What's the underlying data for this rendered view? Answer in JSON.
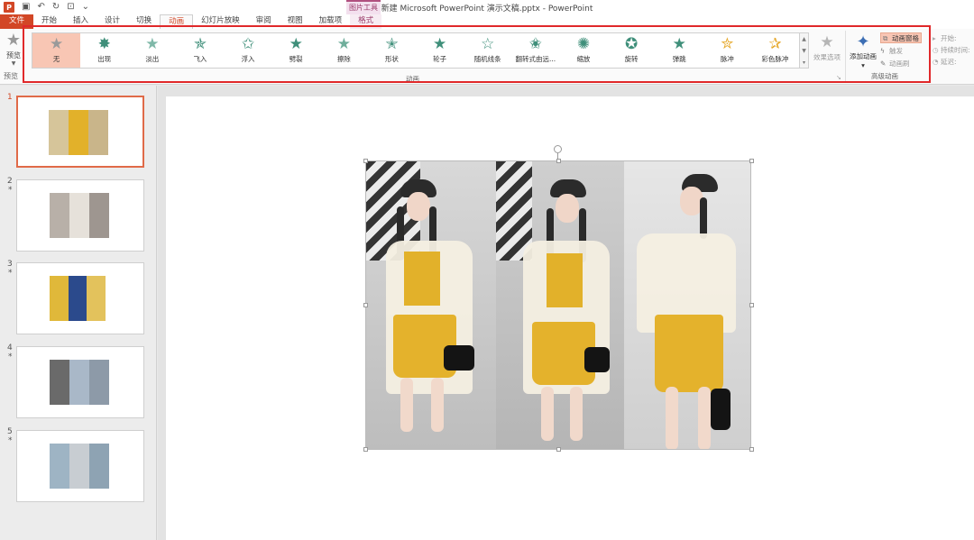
{
  "window": {
    "title": "新建 Microsoft PowerPoint 演示文稿.pptx - PowerPoint",
    "context_tool": "图片工具"
  },
  "tabs": [
    "文件",
    "开始",
    "插入",
    "设计",
    "切换",
    "动画",
    "幻灯片放映",
    "审阅",
    "视图",
    "加载项",
    "格式"
  ],
  "active_tab": "动画",
  "ribbon": {
    "preview": {
      "label": "预览",
      "group": "预览"
    },
    "animations": [
      {
        "label": "无",
        "icon": "star-gray-icon"
      },
      {
        "label": "出现",
        "icon": "star-burst-icon"
      },
      {
        "label": "淡出",
        "icon": "star-fade-icon"
      },
      {
        "label": "飞入",
        "icon": "star-fly-icon"
      },
      {
        "label": "浮入",
        "icon": "star-float-icon"
      },
      {
        "label": "劈裂",
        "icon": "star-split-icon"
      },
      {
        "label": "擦除",
        "icon": "star-wipe-icon"
      },
      {
        "label": "形状",
        "icon": "star-shape-icon"
      },
      {
        "label": "轮子",
        "icon": "star-wheel-icon"
      },
      {
        "label": "随机线条",
        "icon": "star-lines-icon"
      },
      {
        "label": "翻转式由远...",
        "icon": "star-flip-icon"
      },
      {
        "label": "缩放",
        "icon": "star-zoom-icon"
      },
      {
        "label": "旋转",
        "icon": "star-spin-icon"
      },
      {
        "label": "弹跳",
        "icon": "star-bounce-icon"
      },
      {
        "label": "脉冲",
        "icon": "star-pulse-icon"
      },
      {
        "label": "彩色脉冲",
        "icon": "star-color-pulse-icon"
      }
    ],
    "selected_animation": "无",
    "effect_options": "效果选项",
    "group_animation": "动画",
    "advanced": {
      "add_animation": "添加动画",
      "animation_pane": "动画窗格",
      "trigger": "触发",
      "painter": "动画刷",
      "group": "高级动画"
    },
    "timing": {
      "start": "开始:",
      "duration": "持续时间:",
      "delay": "延迟:"
    }
  },
  "slides": [
    {
      "number": "1",
      "has_star": false,
      "active": true
    },
    {
      "number": "2",
      "has_star": true,
      "active": false
    },
    {
      "number": "3",
      "has_star": true,
      "active": false
    },
    {
      "number": "4",
      "has_star": true,
      "active": false
    },
    {
      "number": "5",
      "has_star": true,
      "active": false
    }
  ],
  "star_mark": "*",
  "colors": {
    "accent": "#d24726",
    "selection_fill": "#f8c6b4",
    "highlight_frame": "#e0282a",
    "animation_star": "#3f8f7a"
  }
}
